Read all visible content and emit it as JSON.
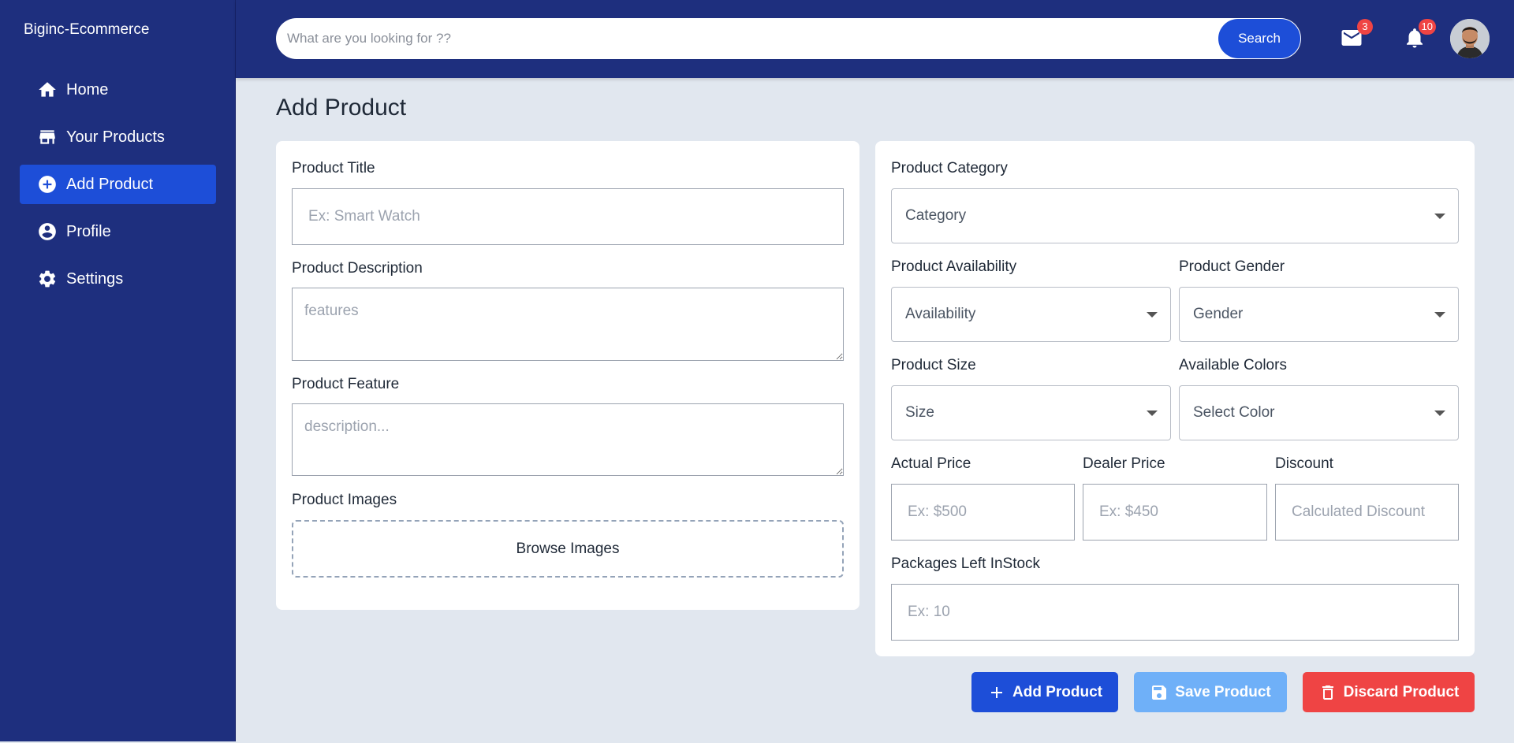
{
  "app": {
    "brand": "Biginc-Ecommerce"
  },
  "sidebar": {
    "items": [
      {
        "label": "Home",
        "icon": "home-icon",
        "active": false
      },
      {
        "label": "Your Products",
        "icon": "store-icon",
        "active": false
      },
      {
        "label": "Add Product",
        "icon": "add-circle-icon",
        "active": true
      },
      {
        "label": "Profile",
        "icon": "user-circle-icon",
        "active": false
      },
      {
        "label": "Settings",
        "icon": "gear-icon",
        "active": false
      }
    ]
  },
  "header": {
    "search_placeholder": "What are you looking for ??",
    "search_button": "Search",
    "mail_badge": "3",
    "notifications_badge": "10"
  },
  "page": {
    "title": "Add Product"
  },
  "form_left": {
    "title_label": "Product Title",
    "title_placeholder": "Ex: Smart Watch",
    "description_label": "Product Description",
    "description_placeholder": "features",
    "feature_label": "Product Feature",
    "feature_placeholder": "description...",
    "images_label": "Product Images",
    "browse_label": "Browse Images"
  },
  "form_right": {
    "category_label": "Product Category",
    "category_value": "Category",
    "availability_label": "Product Availability",
    "availability_value": "Availability",
    "gender_label": "Product Gender",
    "gender_value": "Gender",
    "size_label": "Product Size",
    "size_value": "Size",
    "colors_label": "Available Colors",
    "colors_value": "Select Color",
    "actual_price_label": "Actual Price",
    "actual_price_placeholder": "Ex: $500",
    "dealer_price_label": "Dealer Price",
    "dealer_price_placeholder": "Ex: $450",
    "discount_label": "Discount",
    "discount_placeholder": "Calculated Discount",
    "stock_label": "Packages Left InStock",
    "stock_placeholder": "Ex: 10"
  },
  "actions": {
    "add_label": "Add Product",
    "save_label": "Save Product",
    "discard_label": "Discard Product"
  },
  "colors": {
    "sidebar_bg": "#1e2f7e",
    "accent": "#1d4ed8",
    "save": "#6fb0f8",
    "danger": "#ef4444",
    "page_bg": "#e1e7ef"
  }
}
